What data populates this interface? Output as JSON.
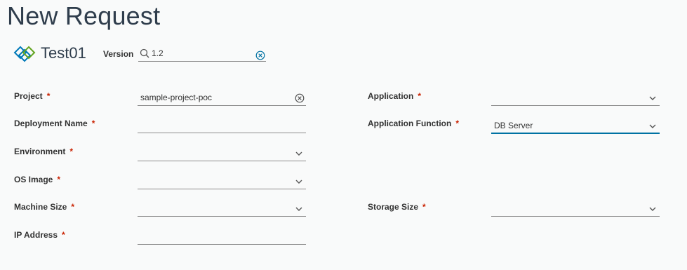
{
  "page": {
    "title": "New Request"
  },
  "blueprint": {
    "name": "Test01",
    "icon": "blueprint-logo-icon"
  },
  "version": {
    "label": "Version",
    "value": "1.2",
    "icon": "search-icon"
  },
  "required_marker": "*",
  "colors": {
    "required": "#c92100",
    "accent": "#0072a3",
    "logo_blue": "#0079b8",
    "logo_green": "#62a420",
    "title": "#2f3d4c"
  },
  "form": {
    "project": {
      "label": "Project",
      "value": "sample-project-poc"
    },
    "deployment_name": {
      "label": "Deployment Name",
      "value": ""
    },
    "environment": {
      "label": "Environment",
      "value": ""
    },
    "os_image": {
      "label": "OS Image",
      "value": ""
    },
    "machine_size": {
      "label": "Machine Size",
      "value": ""
    },
    "ip_address": {
      "label": "IP Address",
      "value": ""
    },
    "application": {
      "label": "Application",
      "value": ""
    },
    "application_function": {
      "label": "Application Function",
      "value": "DB Server"
    },
    "storage_size": {
      "label": "Storage Size",
      "value": ""
    }
  }
}
